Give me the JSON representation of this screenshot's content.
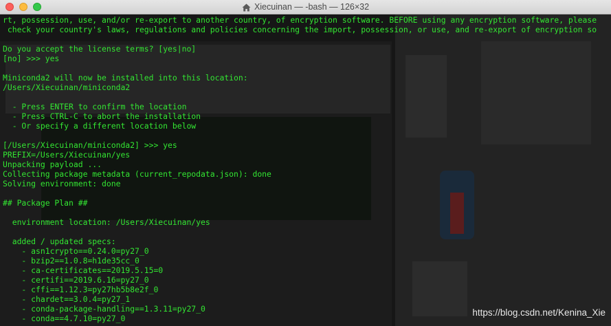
{
  "window": {
    "title": "Xiecuinan — -bash — 126×32"
  },
  "terminal": {
    "lines": [
      "rt, possession, use, and/or re-export to another country, of encryption software. BEFORE using any encryption software, please",
      " check your country's laws, regulations and policies concerning the import, possession, or use, and re-export of encryption so",
      "",
      "Do you accept the license terms? [yes|no]",
      "[no] >>> yes",
      "",
      "Miniconda2 will now be installed into this location:",
      "/Users/Xiecuinan/miniconda2",
      "",
      "  - Press ENTER to confirm the location",
      "  - Press CTRL-C to abort the installation",
      "  - Or specify a different location below",
      "",
      "[/Users/Xiecuinan/miniconda2] >>> yes",
      "PREFIX=/Users/Xiecuinan/yes",
      "Unpacking payload ...",
      "Collecting package metadata (current_repodata.json): done",
      "Solving environment: done",
      "",
      "## Package Plan ##",
      "",
      "  environment location: /Users/Xiecuinan/yes",
      "",
      "  added / updated specs:",
      "    - asn1crypto==0.24.0=py27_0",
      "    - bzip2==1.0.8=h1de35cc_0",
      "    - ca-certificates==2019.5.15=0",
      "    - certifi==2019.6.16=py27_0",
      "    - cffi==1.12.3=py27hb5b8e2f_0",
      "    - chardet==3.0.4=py27_1",
      "    - conda-package-handling==1.3.11=py27_0",
      "    - conda==4.7.10=py27_0"
    ]
  },
  "watermark": "https://blog.csdn.net/Kenina_Xie"
}
